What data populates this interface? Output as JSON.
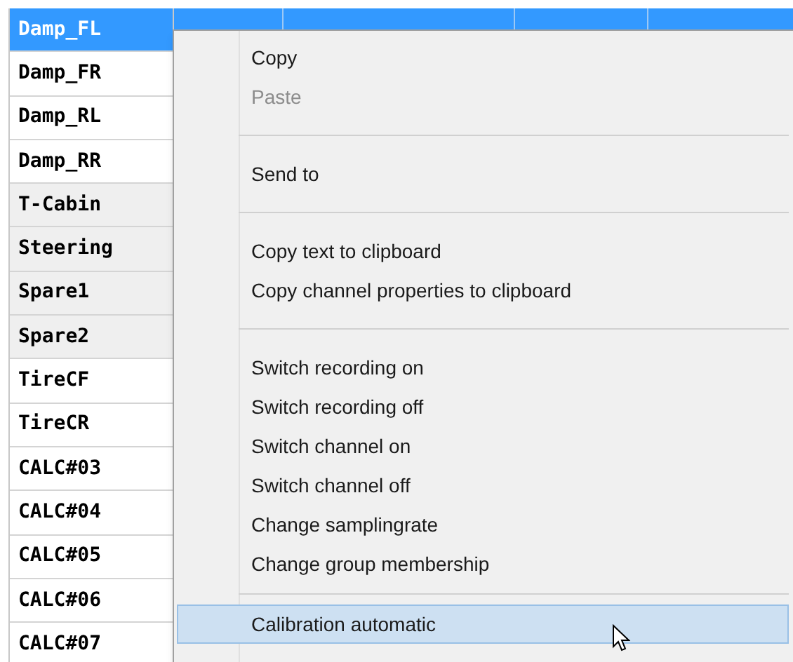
{
  "channels": [
    {
      "name": "Damp_FL",
      "selected": true
    },
    {
      "name": "Damp_FR",
      "selected": false
    },
    {
      "name": "Damp_RL",
      "selected": false
    },
    {
      "name": "Damp_RR",
      "selected": false
    },
    {
      "name": "T-Cabin",
      "selected": false
    },
    {
      "name": "Steering",
      "selected": false
    },
    {
      "name": "Spare1",
      "selected": false
    },
    {
      "name": "Spare2",
      "selected": false
    },
    {
      "name": "TireCF",
      "selected": false
    },
    {
      "name": "TireCR",
      "selected": false
    },
    {
      "name": "CALC#03",
      "selected": false
    },
    {
      "name": "CALC#04",
      "selected": false
    },
    {
      "name": "CALC#05",
      "selected": false
    },
    {
      "name": "CALC#06",
      "selected": false
    },
    {
      "name": "CALC#07",
      "selected": false
    }
  ],
  "context_menu": {
    "items": [
      {
        "kind": "item",
        "label": "Copy",
        "disabled": false,
        "selected": false
      },
      {
        "kind": "item",
        "label": "Paste",
        "disabled": true,
        "selected": false
      },
      {
        "kind": "separator"
      },
      {
        "kind": "item",
        "label": "Send to",
        "disabled": false,
        "selected": false
      },
      {
        "kind": "separator"
      },
      {
        "kind": "item",
        "label": "Copy text to clipboard",
        "disabled": false,
        "selected": false
      },
      {
        "kind": "item",
        "label": "Copy channel properties to clipboard",
        "disabled": false,
        "selected": false
      },
      {
        "kind": "separator"
      },
      {
        "kind": "item",
        "label": "Switch recording on",
        "disabled": false,
        "selected": false
      },
      {
        "kind": "item",
        "label": "Switch recording off",
        "disabled": false,
        "selected": false
      },
      {
        "kind": "item",
        "label": "Switch channel on",
        "disabled": false,
        "selected": false
      },
      {
        "kind": "item",
        "label": "Switch channel off",
        "disabled": false,
        "selected": false
      },
      {
        "kind": "item",
        "label": "Change samplingrate",
        "disabled": false,
        "selected": false
      },
      {
        "kind": "item",
        "label": "Change group membership",
        "disabled": false,
        "selected": false
      },
      {
        "kind": "separator"
      },
      {
        "kind": "item",
        "label": "Calibration automatic",
        "disabled": false,
        "selected": true
      }
    ]
  }
}
